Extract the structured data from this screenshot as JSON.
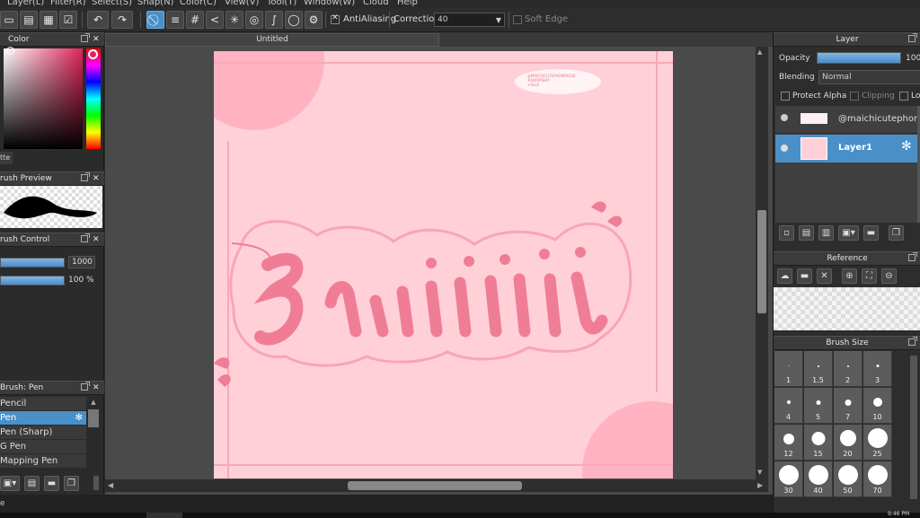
{
  "menu": [
    "Layer(L)",
    "Filter(R)",
    "Select(S)",
    "Snap(N)",
    "Color(C)",
    "View(V)",
    "Tool(T)",
    "Window(W)",
    "Cloud",
    "Help"
  ],
  "toolbar": {
    "antialias_label": "AntiAliasing",
    "correction_label": "Correction",
    "correction_value": "40",
    "soft_edge_label": "Soft Edge"
  },
  "color_panel": {
    "title": "Color",
    "tab": "tte"
  },
  "brush_preview": {
    "title": "rush Preview"
  },
  "brush_control": {
    "title": "rush Control",
    "size": "1000",
    "opacity": "100 %",
    "size_fraction": 1.0,
    "opacity_fraction": 1.0
  },
  "brush_list": {
    "title": "Brush: Pen",
    "items": [
      {
        "label": "Pencil",
        "selected": false
      },
      {
        "label": "Pen",
        "selected": true
      },
      {
        "label": "Pen (Sharp)",
        "selected": false
      },
      {
        "label": "G Pen",
        "selected": false
      },
      {
        "label": "Mapping Pen",
        "selected": false
      }
    ]
  },
  "document": {
    "tab_title": "Untitled"
  },
  "canvas": {
    "note_line1": "@MAICHICUTEPHOM/AGUE",
    "note_line2": "#ADRIPSHIT",
    "note_line3": "+Rush",
    "colors": {
      "bg": "#ffd0d8",
      "accent": "#f07d96",
      "blob": "#ffb3c2",
      "frame": "#f5a9b8"
    }
  },
  "layer_panel": {
    "title": "Layer",
    "opacity_label": "Opacity",
    "opacity_value": "100",
    "opacity_fraction": 1.0,
    "blending_label": "Blending",
    "blending_value": "Normal",
    "protect_alpha": "Protect Alpha",
    "clipping": "Clipping",
    "lock": "Loc",
    "layers": [
      {
        "name": "@maichicutephom",
        "selected": false
      },
      {
        "name": "Layer1",
        "selected": true
      }
    ]
  },
  "reference_panel": {
    "title": "Reference"
  },
  "brush_size_panel": {
    "title": "Brush Size",
    "sizes": [
      "1",
      "1.5",
      "2",
      "3",
      "4",
      "5",
      "7",
      "10",
      "12",
      "15",
      "20",
      "25",
      "30",
      "40",
      "50",
      "70"
    ]
  },
  "statusbar": {
    "left": "e",
    "time": "9:46 PM"
  },
  "accent_color": "#4a90c8"
}
